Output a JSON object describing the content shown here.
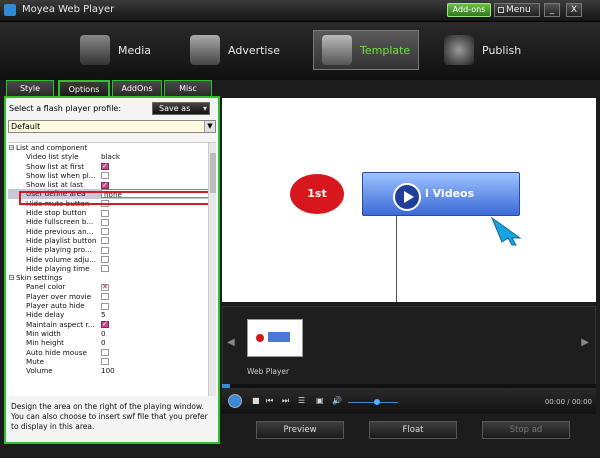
{
  "window": {
    "title": "Moyea Web Player",
    "addons_label": "Add-ons",
    "menu_label": "Menu",
    "minimize": "_",
    "close": "X"
  },
  "nav": [
    {
      "label": "Media"
    },
    {
      "label": "Advertise"
    },
    {
      "label": "Template"
    },
    {
      "label": "Publish"
    }
  ],
  "tabs": [
    {
      "label": "Style"
    },
    {
      "label": "Options"
    },
    {
      "label": "AddOns"
    },
    {
      "label": "Misc"
    }
  ],
  "profile": {
    "label": "Select a flash player profile:",
    "save_as": "Save as",
    "selected": "Default"
  },
  "properties": {
    "cat1": "List and component",
    "rows1": [
      {
        "name": "Video list style",
        "value": "black"
      },
      {
        "name": "Show list at first",
        "value": ""
      },
      {
        "name": "Show list when pl...",
        "value": ""
      },
      {
        "name": "Show list at last",
        "value": ""
      },
      {
        "name": "User define area",
        "value": "none"
      },
      {
        "name": "Hide mute button",
        "value": ""
      },
      {
        "name": "Hide stop button",
        "value": ""
      },
      {
        "name": "Hide fullscreen b...",
        "value": ""
      },
      {
        "name": "Hide previous an...",
        "value": ""
      },
      {
        "name": "Hide playlist button",
        "value": ""
      },
      {
        "name": "Hide playing pro...",
        "value": ""
      },
      {
        "name": "Hide volume adju...",
        "value": ""
      },
      {
        "name": "Hide playing time",
        "value": ""
      }
    ],
    "cat2": "Skin settings",
    "rows2": [
      {
        "name": "Panel color",
        "value": ""
      },
      {
        "name": "Player over movie",
        "value": ""
      },
      {
        "name": "Player auto hide",
        "value": ""
      },
      {
        "name": "Hide delay",
        "value": "5"
      },
      {
        "name": "Maintain aspect r...",
        "value": ""
      },
      {
        "name": "Min width",
        "value": "0"
      },
      {
        "name": "Min height",
        "value": "0"
      },
      {
        "name": "Auto hide mouse",
        "value": ""
      },
      {
        "name": "Mute",
        "value": ""
      },
      {
        "name": "Volume",
        "value": "100"
      }
    ]
  },
  "description": "Design the area on the right of the playing window. You can also choose to insert swf file that you prefer to display in this area.",
  "preview": {
    "badge": "1st",
    "button_label": "l Videos"
  },
  "thumbnail": {
    "label": "Web Player"
  },
  "player": {
    "time": "00:00 / 00:00"
  },
  "buttons": {
    "preview": "Preview",
    "float": "Float",
    "stop_ad": "Stop ad"
  }
}
